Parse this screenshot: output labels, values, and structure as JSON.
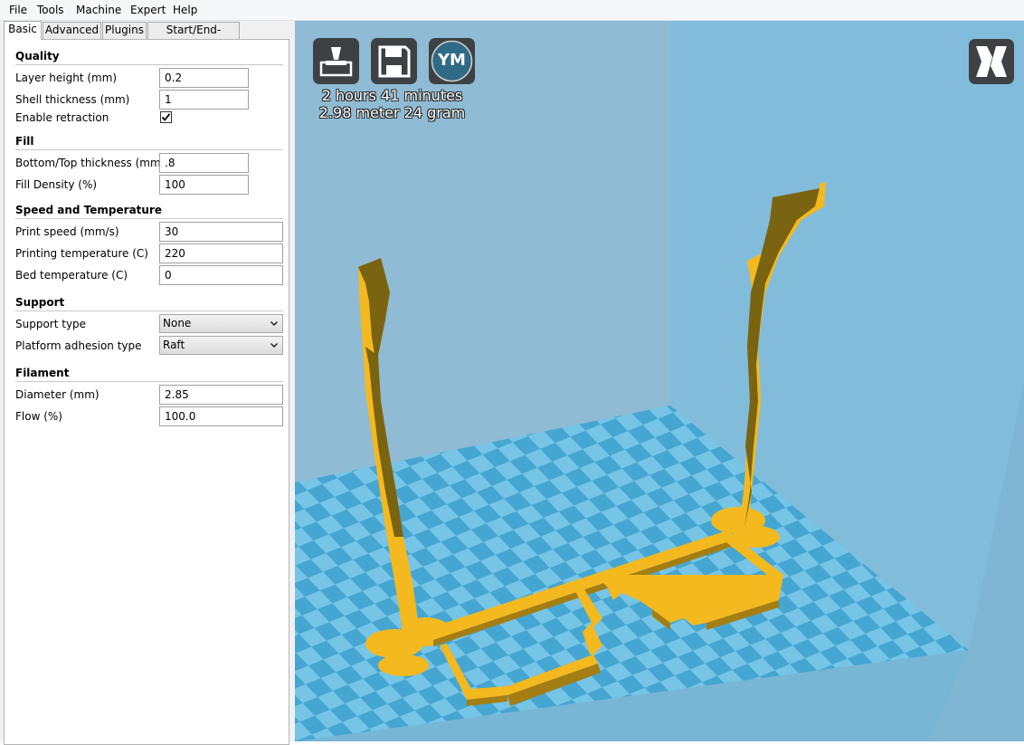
{
  "menu": [
    "File",
    "Tools",
    "Machine",
    "Expert",
    "Help"
  ],
  "tabs": [
    {
      "label": "Basic",
      "active": true
    },
    {
      "label": "Advanced",
      "active": false
    },
    {
      "label": "Plugins",
      "active": false
    },
    {
      "label": "Start/End-GCode",
      "active": false
    }
  ],
  "quality": {
    "header": "Quality",
    "layer_height_label": "Layer height (mm)",
    "layer_height_value": "0.2",
    "shell_thickness_label": "Shell thickness (mm)",
    "shell_thickness_value": "1",
    "retraction_label": "Enable retraction",
    "retraction_checked": true
  },
  "fill": {
    "header": "Fill",
    "bottom_top_label": "Bottom/Top thickness (mm)",
    "bottom_top_value": ".8",
    "density_label": "Fill Density (%)",
    "density_value": "100"
  },
  "speed": {
    "header": "Speed and Temperature",
    "print_speed_label": "Print speed (mm/s)",
    "print_speed_value": "30",
    "print_temp_label": "Printing temperature (C)",
    "print_temp_value": "220",
    "bed_temp_label": "Bed temperature (C)",
    "bed_temp_value": "0"
  },
  "support": {
    "header": "Support",
    "support_type_label": "Support type",
    "support_type_value": "None",
    "adhesion_label": "Platform adhesion type",
    "adhesion_value": "Raft"
  },
  "filament": {
    "header": "Filament",
    "diameter_label": "Diameter (mm)",
    "diameter_value": "2.85",
    "flow_label": "Flow (%)",
    "flow_value": "100.0"
  },
  "viewport": {
    "print_time": "2 hours 41 minutes",
    "print_material": "2.98 meter 24 gram",
    "ym_button_label": "YM",
    "icons": {
      "load": "load-model-icon",
      "save": "save-toolpath-icon",
      "youmagine": "youmagine-icon",
      "view_mode": "view-mode-icon"
    }
  },
  "colors": {
    "bed_light": "#76c5e6",
    "bed_dark": "#46a6d2",
    "wall_left": "#8fbbd4",
    "wall_back": "#82bcdb",
    "model": "#f4b91f",
    "model_dark": "#7a6412",
    "button": "#3d4143",
    "ym_circle": "#2f6a86"
  }
}
